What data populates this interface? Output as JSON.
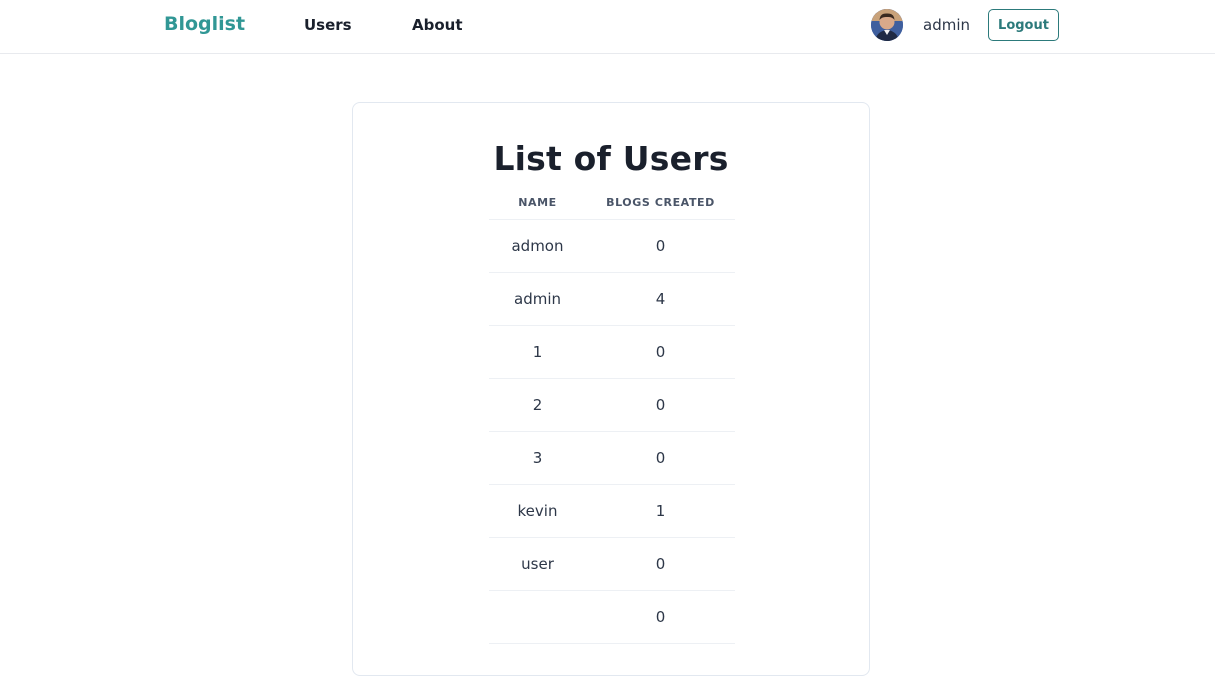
{
  "header": {
    "brand": "Bloglist",
    "nav": [
      {
        "label": "Users"
      },
      {
        "label": "About"
      }
    ],
    "user": {
      "name": "admin",
      "logout_label": "Logout"
    }
  },
  "main": {
    "title": "List of Users",
    "table": {
      "columns": [
        "Name",
        "Blogs Created"
      ],
      "rows": [
        {
          "name": "admon",
          "blogs": "0"
        },
        {
          "name": "admin",
          "blogs": "4"
        },
        {
          "name": "1",
          "blogs": "0"
        },
        {
          "name": "2",
          "blogs": "0"
        },
        {
          "name": "3",
          "blogs": "0"
        },
        {
          "name": "kevin",
          "blogs": "1"
        },
        {
          "name": "user",
          "blogs": "0"
        },
        {
          "name": "",
          "blogs": "0"
        }
      ]
    }
  },
  "colors": {
    "brand": "#319795",
    "button_border": "#2c7a7b",
    "divider": "#e2e8f0"
  },
  "icons": {
    "avatar": "user-avatar-photo"
  }
}
